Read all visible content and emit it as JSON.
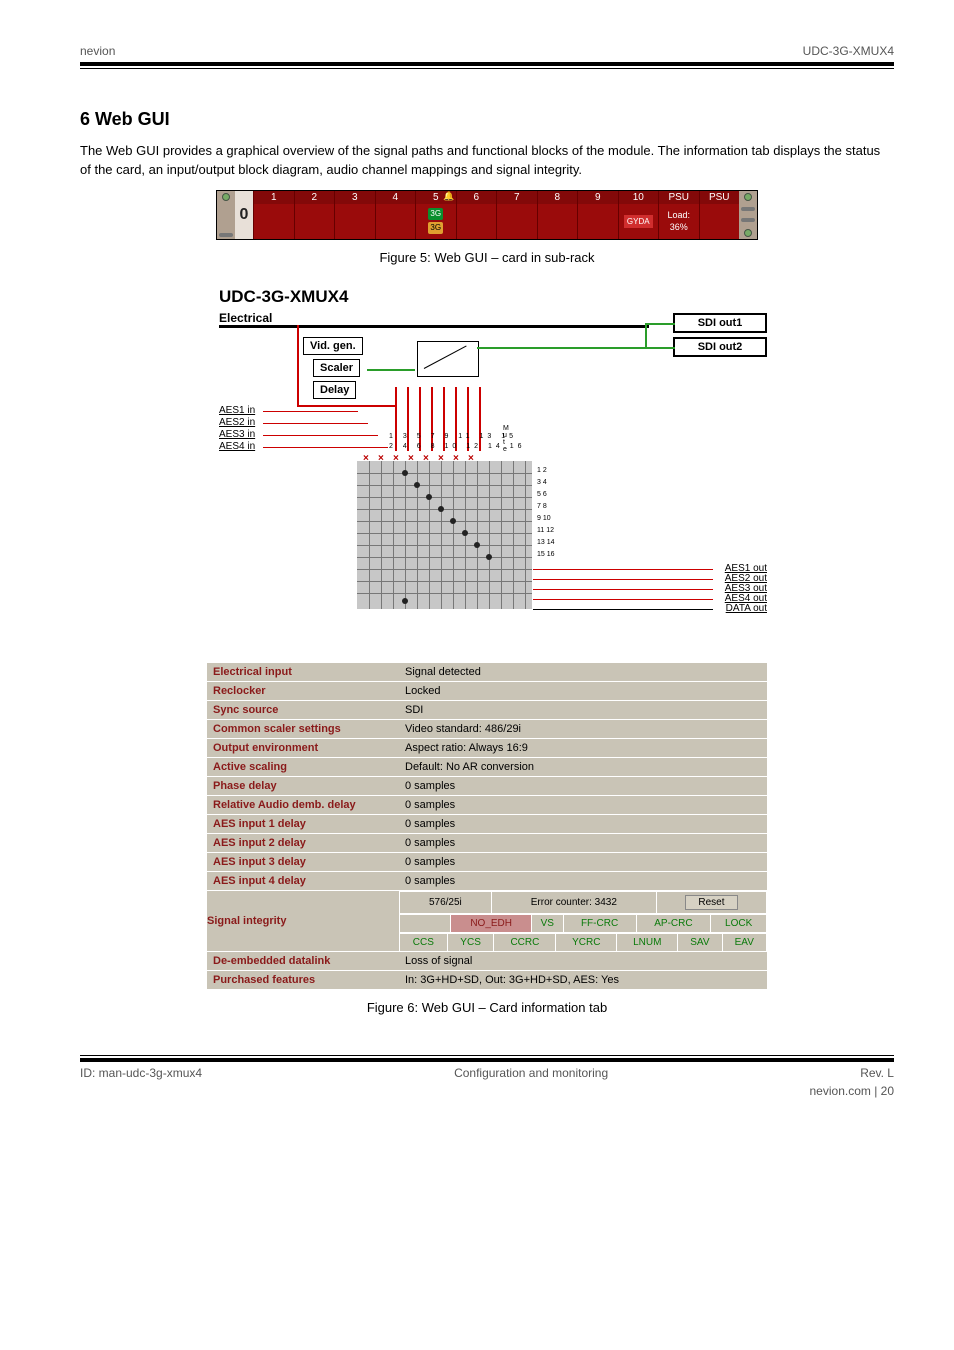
{
  "header": {
    "left": "nevion",
    "right": "UDC-3G-XMUX4"
  },
  "heading": "6 Web GUI",
  "intro": "The Web GUI provides a graphical overview of the signal paths and functional blocks of the module. The information tab displays the status of the card, an input/output block diagram, audio channel mappings and signal integrity.",
  "rack": {
    "slots": [
      "1",
      "2",
      "3",
      "4",
      "5",
      "6",
      "7",
      "8",
      "9",
      "10"
    ],
    "active_slot": "5",
    "active_badges": [
      "3G",
      "3G"
    ],
    "gyda_slot": "10",
    "gyda_label": "GYDA",
    "psu": [
      {
        "label": "PSU",
        "load": "Load:",
        "pct": "36%"
      },
      {
        "label": "PSU",
        "load": "",
        "pct": ""
      }
    ],
    "frame_num": "0"
  },
  "figure1_caption": "Figure 5: Web GUI – card in sub-rack",
  "diagram": {
    "title": "UDC-3G-XMUX4",
    "electrical": "Electrical",
    "blocks": {
      "vidgen": "Vid. gen.",
      "scaler": "Scaler",
      "delay": "Delay"
    },
    "sdi_out": [
      "SDI out1",
      "SDI out2"
    ],
    "aes_in": [
      "AES1 in",
      "AES2 in",
      "AES3 in",
      "AES4 in"
    ],
    "aes_out": [
      "AES1 out",
      "AES2 out",
      "AES3 out",
      "AES4 out",
      "DATA out"
    ],
    "matrix_cols_top": [
      "1",
      "3",
      "5",
      "7",
      "9",
      "11",
      "13",
      "15",
      "1 k"
    ],
    "matrix_cols_bot": [
      "2",
      "4",
      "6",
      "8",
      "10",
      "12",
      "14",
      "16",
      "z"
    ],
    "matrix_right_label": "M\nu\nt\ne",
    "matrix_out_rows": [
      "1 2",
      "3 4",
      "5 6",
      "7 8",
      "9 10",
      "11 12",
      "13 14",
      "15 16"
    ]
  },
  "status": {
    "rows": [
      {
        "label": "Electrical input",
        "value": "Signal detected"
      },
      {
        "label": "Reclocker",
        "value": "Locked"
      },
      {
        "label": "Sync source",
        "value": "SDI"
      },
      {
        "label": "Common scaler settings",
        "value": "Video standard: 486/29i"
      },
      {
        "label": "Output environment",
        "value": "Aspect ratio: Always 16:9"
      },
      {
        "label": "Active scaling",
        "value": "Default: No AR conversion"
      },
      {
        "label": "Phase delay",
        "value": "0 samples"
      },
      {
        "label": "Relative Audio demb. delay",
        "value": "0 samples"
      },
      {
        "label": "AES input 1 delay",
        "value": "0 samples"
      },
      {
        "label": "AES input 2 delay",
        "value": "0 samples"
      },
      {
        "label": "AES input 3 delay",
        "value": "0 samples"
      },
      {
        "label": "AES input 4 delay",
        "value": "0 samples"
      }
    ],
    "signal_integrity": {
      "label": "Signal integrity",
      "std": "576/25i",
      "err_label": "Error counter: 3432",
      "reset": "Reset",
      "row1": [
        "",
        "NO_EDH",
        "VS",
        "FF-CRC",
        "AP-CRC",
        "LOCK"
      ],
      "row2": [
        "CCS",
        "YCS",
        "CCRC",
        "YCRC",
        "LNUM",
        "SAV",
        "EAV"
      ]
    },
    "deembedded": {
      "label": "De-embedded datalink",
      "value": "Loss of signal"
    },
    "purchased": {
      "label": "Purchased features",
      "value": "In: 3G+HD+SD, Out: 3G+HD+SD, AES: Yes"
    }
  },
  "figure2_caption": "Figure 6: Web GUI – Card information tab",
  "footer": {
    "left": "ID: man-udc-3g-xmux4",
    "center": "Configuration and monitoring",
    "right": "Rev. L"
  },
  "page_number": "nevion.com | 20"
}
